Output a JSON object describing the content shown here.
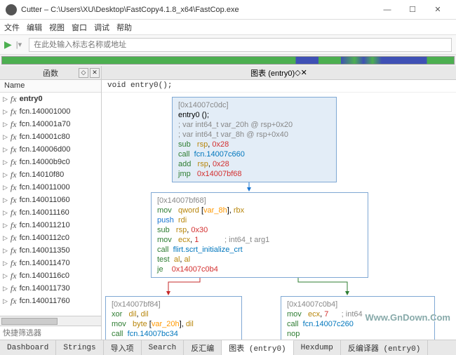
{
  "window": {
    "title": "Cutter – C:\\Users\\XU\\Desktop\\FastCopy4.1.8_x64\\FastCop.exe"
  },
  "menu": [
    "文件",
    "编辑",
    "视图",
    "窗口",
    "调试",
    "帮助"
  ],
  "toolbar": {
    "search_placeholder": "在此处输入标志名称或地址"
  },
  "panels": {
    "functions": "函数",
    "graph": "图表 (entry0)",
    "name_col": "Name"
  },
  "functions": [
    {
      "name": "entry0",
      "bold": true
    },
    {
      "name": "fcn.140001000"
    },
    {
      "name": "fcn.140001a70"
    },
    {
      "name": "fcn.140001c80"
    },
    {
      "name": "fcn.140006d00"
    },
    {
      "name": "fcn.14000b9c0"
    },
    {
      "name": "fcn.14010f80"
    },
    {
      "name": "fcn.140011000"
    },
    {
      "name": "fcn.140011060"
    },
    {
      "name": "fcn.140011160"
    },
    {
      "name": "fcn.140011210"
    },
    {
      "name": "fcn.1400112c0"
    },
    {
      "name": "fcn.140011350"
    },
    {
      "name": "fcn.140011470"
    },
    {
      "name": "fcn.1400116c0"
    },
    {
      "name": "fcn.140011730"
    },
    {
      "name": "fcn.140011760"
    }
  ],
  "filter": {
    "placeholder": "快捷筛选器"
  },
  "signature": "void entry0();",
  "nodes": {
    "n1": {
      "addr": "[0x14007c0dc]",
      "lines": [
        {
          "t": "entry0 ();",
          "cls": ""
        },
        {
          "t": "; var int64_t var_20h @ rsp+0x20",
          "cls": "cmt kwred"
        },
        {
          "t": "; var int64_t var_8h @ rsp+0x40",
          "cls": "cmt kwred"
        },
        {
          "html": "<span class='kw'>sub</span>&nbsp;&nbsp;&nbsp;<span class='reg'>rsp</span>, <span class='num'>0x28</span>"
        },
        {
          "html": "<span class='kw'>call</span>&nbsp;&nbsp;<span class='fn'>fcn.14007c660</span>"
        },
        {
          "html": "<span class='kw'>add</span>&nbsp;&nbsp;&nbsp;<span class='reg'>rsp</span>, <span class='num'>0x28</span>"
        },
        {
          "html": "<span class='kw'>jmp</span>&nbsp;&nbsp;&nbsp;<span class='num'>0x14007bf68</span>"
        }
      ]
    },
    "n2": {
      "addr": "[0x14007bf68]",
      "lines": [
        {
          "html": "<span class='kw'>mov</span>&nbsp;&nbsp;&nbsp;<span class='reg'>qword</span> [<span class='var'>var_8h</span>], <span class='reg'>rbx</span>"
        },
        {
          "html": "<span class='kwblue'>push</span>&nbsp;&nbsp;<span class='reg'>rdi</span>"
        },
        {
          "html": "<span class='kw'>sub</span>&nbsp;&nbsp;&nbsp;<span class='reg'>rsp</span>, <span class='num'>0x30</span>"
        },
        {
          "html": "<span class='kw'>mov</span>&nbsp;&nbsp;&nbsp;<span class='reg'>ecx</span>, <span class='num'>1</span>&nbsp;&nbsp;&nbsp;&nbsp;&nbsp;&nbsp;&nbsp;&nbsp;&nbsp;&nbsp;&nbsp;&nbsp;<span class='cmt'>; int64_t arg1</span>"
        },
        {
          "html": "<span class='kw'>call</span>&nbsp;&nbsp;<span class='fn'>flirt.scrt_initialize_crt</span>"
        },
        {
          "html": "<span class='kw'>test</span>&nbsp;&nbsp;<span class='reg'>al</span>, <span class='reg'>al</span>"
        },
        {
          "html": "<span class='kw'>je</span>&nbsp;&nbsp;&nbsp;&nbsp;<span class='num'>0x14007c0b4</span>"
        }
      ]
    },
    "n3": {
      "addr": "[0x14007bf84]",
      "lines": [
        {
          "html": "<span class='kw'>xor</span>&nbsp;&nbsp;&nbsp;<span class='reg'>dil</span>, <span class='reg'>dil</span>"
        },
        {
          "html": "<span class='kw'>mov</span>&nbsp;&nbsp;&nbsp;<span class='reg'>byte</span> [<span class='var'>var_20h</span>], <span class='reg'>dil</span>"
        },
        {
          "html": "<span class='kw'>call</span>&nbsp;&nbsp;<span class='fn'>fcn.14007bc34</span>"
        }
      ]
    },
    "n4": {
      "addr": "[0x14007c0b4]",
      "lines": [
        {
          "html": "<span class='kw'>mov</span>&nbsp;&nbsp;&nbsp;<span class='reg'>ecx</span>, <span class='num'>7</span>&nbsp;&nbsp;&nbsp;&nbsp;&nbsp;&nbsp;<span class='cmt'>; int64</span>"
        },
        {
          "html": "<span class='kw'>call</span>&nbsp;&nbsp;<span class='fn'>fcn.14007c260</span>"
        },
        {
          "html": "<span class='kw'>nop</span>"
        }
      ]
    }
  },
  "tabs": [
    "Dashboard",
    "Strings",
    "导入项",
    "Search",
    "反汇编",
    "图表 (entry0)",
    "Hexdump",
    "反编译器 (entry0)"
  ],
  "active_tab": 5,
  "watermark": "Www.GnDown.Com"
}
